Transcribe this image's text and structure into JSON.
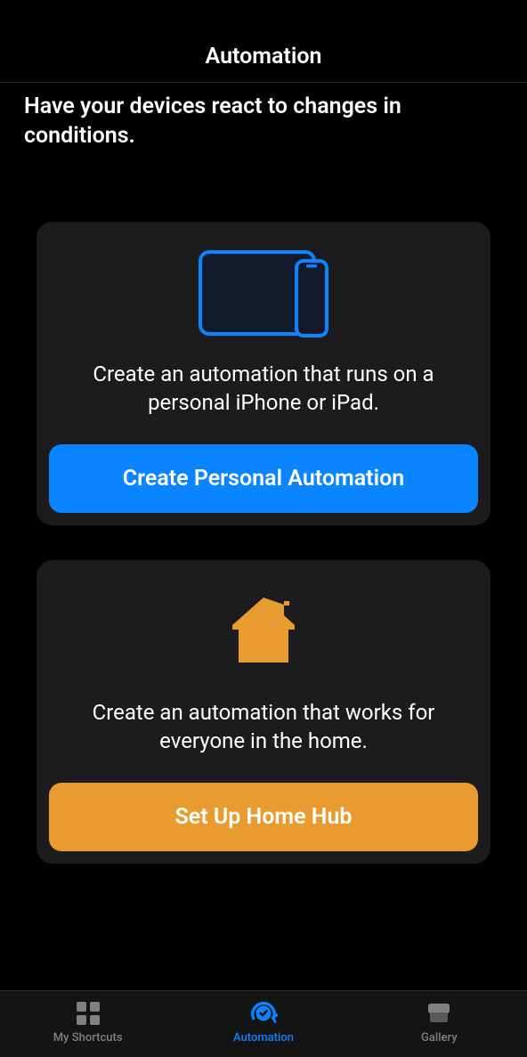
{
  "header": {
    "title": "Automation"
  },
  "subtitle": "Have your devices react to changes in conditions.",
  "cards": [
    {
      "icon": "devices-icon",
      "description": "Create an automation that runs on a personal iPhone or iPad.",
      "button_label": "Create Personal Automation",
      "button_color": "#0a84ff"
    },
    {
      "icon": "home-icon",
      "description": "Create an automation that works for everyone in the home.",
      "button_label": "Set Up Home Hub",
      "button_color": "#e89c2f"
    }
  ],
  "tabs": [
    {
      "icon": "grid-icon",
      "label": "My Shortcuts",
      "active": false
    },
    {
      "icon": "automation-icon",
      "label": "Automation",
      "active": true
    },
    {
      "icon": "gallery-icon",
      "label": "Gallery",
      "active": false
    }
  ],
  "colors": {
    "accent_blue": "#0a84ff",
    "accent_orange": "#e89c2f",
    "card_bg": "#1c1c1e",
    "inactive": "#808080"
  }
}
